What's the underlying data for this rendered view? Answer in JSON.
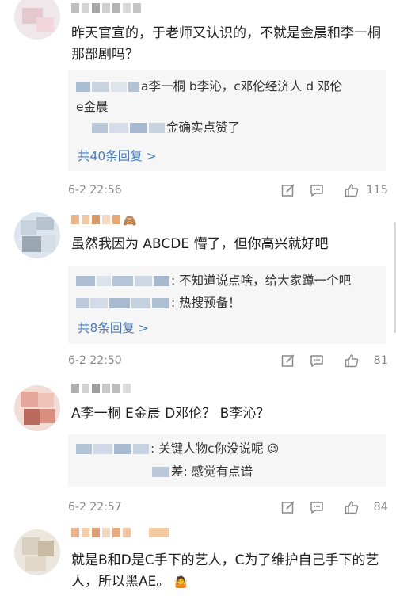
{
  "comments": [
    {
      "text": "昨天官宣的，于老师又认识的，不就是金晨和李一桐那部剧吗？",
      "replies": [
        {
          "text": "a李一桐 b李沁，c邓伦经济人 d 邓伦"
        },
        {
          "text": "e金晨"
        },
        {
          "text": "金确实点赞了"
        }
      ],
      "more_replies": "共40条回复 >",
      "time": "6-2 22:56",
      "likes": "115"
    },
    {
      "text": "虽然我因为 ABCDE 懵了，但你高兴就好吧",
      "replies": [
        {
          "text": ": 不知道说点啥，给大家蹲一个吧"
        },
        {
          "text": ": 热搜预备！"
        }
      ],
      "more_replies": "共8条回复 >",
      "time": "6-2 22:50",
      "likes": "81"
    },
    {
      "text": "A李一桐 E金晨 D邓伦？ B李沁？",
      "replies": [
        {
          "text": ": 关键人物c你没说呢"
        },
        {
          "text": "差: 感觉有点谱"
        }
      ],
      "time": "6-2 22:57",
      "likes": "84"
    },
    {
      "text": "就是B和D是C手下的艺人，C为了维护自己手下的艺人，所以黑AE。"
    }
  ],
  "icons": {
    "edit": "edit-icon",
    "comment": "comment-icon",
    "like": "thumbs-up-icon"
  },
  "colors": {
    "link": "#4a7bb7",
    "reply_bg": "#f6f6f6",
    "meta": "#8a8a8a"
  }
}
